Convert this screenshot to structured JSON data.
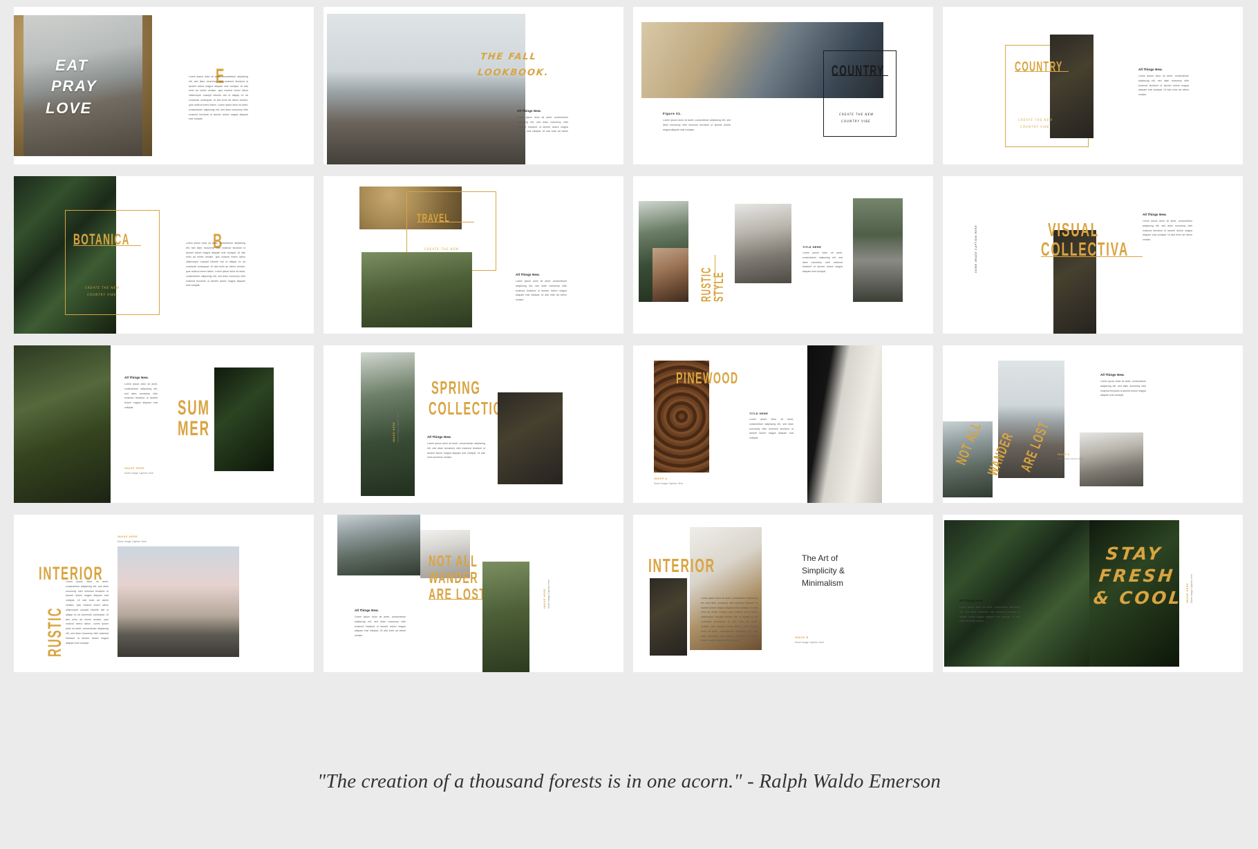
{
  "page": {
    "background": "#ebebeb",
    "accent_gold": "#d9a441",
    "ink": "#1b1b1b",
    "quote": "\"The creation of a thousand forests is in one acorn.\" - Ralph Waldo Emerson"
  },
  "common": {
    "heading_all_things_new": "All Things New.",
    "lorem_long": "Lorem ipsum dolor sit amet, consectetuer adipiscing elit, sed diam nonummy nibh euismod tincidunt ut laoreet dolore magna aliquam erat volutpat. Ut wisi enim ad minim veniam, quis nostrud exerci tation ullamcorper suscipit lobortis nisl ut aliquip ex ea commodo consequat. Ut wisi enim ad minim veniam, quis nostrud exerci tation. Lorem ipsum dolor sit amet, consectetuer adipiscing elit, sed diam nonummy nibh euismod tincidunt ut laoreet dolore magna aliquam erat volutpat.",
    "lorem_mid": "Lorem ipsum dolor sit amet, consectetuer adipiscing elit, sed diam nonummy nibh euismod tincidunt ut laoreet dolore magna aliquam erat volutpat. Ut wisi enim ad minim veniam.",
    "lorem_short": "Lorem ipsum dolor sit amet, consectetuer adipiscing elit, sed diam nonummy nibh euismod tincidunt ut laoreet dolore magna aliquam erat volutpat.",
    "tagline": "CREATE THE NEW COUNTRY VIBE",
    "tagline_l1": "CREATE THE NEW",
    "tagline_l2": "COUNTRY VIBE",
    "image_here": "IMAGE HERE",
    "image_caption": "Some Image Caption Here",
    "figure_label": "Figure 01.",
    "title_here": "TITLE HERE",
    "image_a": "IMAGE A",
    "image_b": "IMAGE B"
  },
  "slides": [
    {
      "id": "slide-eat-pray-love",
      "shirt": [
        "EAT",
        "PRAY",
        "LOVE"
      ],
      "dropcap": "E"
    },
    {
      "id": "slide-the-fall-lookbook",
      "title_l1": "THE FALL",
      "title_l2": "LOOKBOOK."
    },
    {
      "id": "slide-country-figure",
      "title": "COUNTRY"
    },
    {
      "id": "slide-country-gold",
      "title": "COUNTRY"
    },
    {
      "id": "slide-botanica",
      "title": "BOTANICA",
      "dropcap": "B"
    },
    {
      "id": "slide-travel",
      "title": "TRAVEL"
    },
    {
      "id": "slide-rustic-style",
      "title_l1": "RUSTIC",
      "title_l2": "STYLE"
    },
    {
      "id": "slide-visual-collectiva",
      "title_l1": "VISUAL",
      "title_l2": "COLLECTIVA"
    },
    {
      "id": "slide-summer",
      "title_l1": "SUM",
      "title_l2": "MER"
    },
    {
      "id": "slide-spring-collection",
      "title_l1": "SPRING",
      "title_l2": "COLLECTION"
    },
    {
      "id": "slide-pinewood",
      "title": "PINEWOOD"
    },
    {
      "id": "slide-not-all-wander",
      "title_l1": "NOT ALL",
      "title_l2": "WANDER",
      "title_l3": "ARE LOST"
    },
    {
      "id": "slide-rustic-interior",
      "title_l1": "INTERIOR",
      "title_l2": "RUSTIC"
    },
    {
      "id": "slide-not-all-wander-are-lost",
      "title_l1": "NOT ALL",
      "title_l2": "WANDER",
      "title_l3": "ARE LOST"
    },
    {
      "id": "slide-interior-art",
      "title": "INTERIOR",
      "sub_l1": "The Art of",
      "sub_l2": "Simplicity &",
      "sub_l3": "Minimalism"
    },
    {
      "id": "slide-stay-fresh-cool",
      "title_l1": "STAY",
      "title_l2": "FRESH",
      "title_l3": "& COOL"
    }
  ]
}
